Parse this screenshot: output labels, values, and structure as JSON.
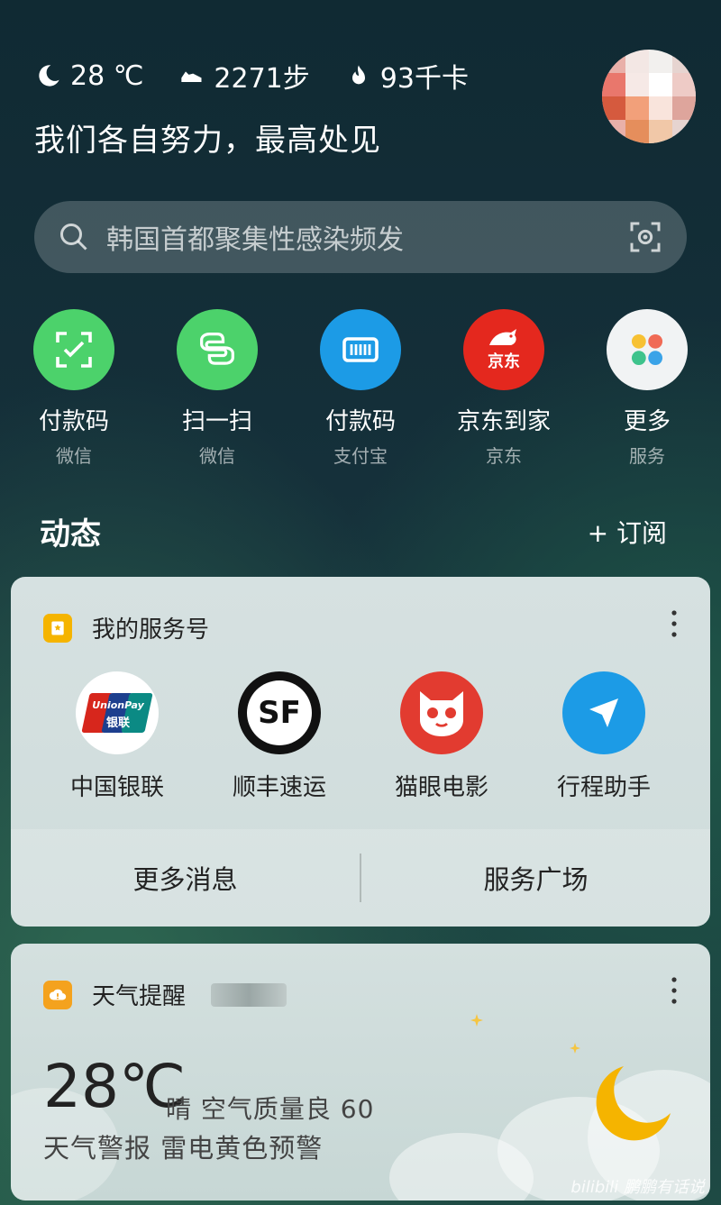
{
  "header": {
    "weather_temp": "28 ℃",
    "steps": "2271步",
    "calories": "93千卡",
    "motto": "我们各自努力，最高处见"
  },
  "search": {
    "placeholder": "韩国首都聚集性感染频发"
  },
  "quick_actions": [
    {
      "label": "付款码",
      "sub": "微信",
      "icon": "wechat-pay-code-icon",
      "color": "#4cd26b"
    },
    {
      "label": "扫一扫",
      "sub": "微信",
      "icon": "wechat-scan-icon",
      "color": "#4cd26b"
    },
    {
      "label": "付款码",
      "sub": "支付宝",
      "icon": "alipay-pay-code-icon",
      "color": "#1c9be6"
    },
    {
      "label": "京东到家",
      "sub": "京东",
      "icon": "jd-icon",
      "color": "#e4281e",
      "badge": "京东"
    },
    {
      "label": "更多",
      "sub": "服务",
      "icon": "more-services-icon",
      "color": "#f1f3f4"
    }
  ],
  "feed": {
    "title": "动态",
    "subscribe": "+ 订阅"
  },
  "service_card": {
    "title": "我的服务号",
    "services": [
      {
        "label": "中国银联",
        "icon": "unionpay-icon",
        "logo_top": "UnionPay",
        "logo_bottom": "银联"
      },
      {
        "label": "顺丰速运",
        "icon": "sf-express-icon",
        "logo": "SF"
      },
      {
        "label": "猫眼电影",
        "icon": "maoyan-icon"
      },
      {
        "label": "行程助手",
        "icon": "trip-assistant-icon"
      }
    ],
    "footer_left": "更多消息",
    "footer_right": "服务广场"
  },
  "weather_card": {
    "title": "天气提醒",
    "temperature": "28℃",
    "condition": "晴  空气质量良  60",
    "alert": "天气警报 雷电黄色预警"
  },
  "watermark": "bilibili 鹏鹏有话说",
  "colors": {
    "accent_green": "#4cd26b",
    "alipay_blue": "#1c9be6",
    "jd_red": "#e4281e",
    "service_yellow": "#f5b400",
    "weather_orange": "#f4a21e"
  }
}
